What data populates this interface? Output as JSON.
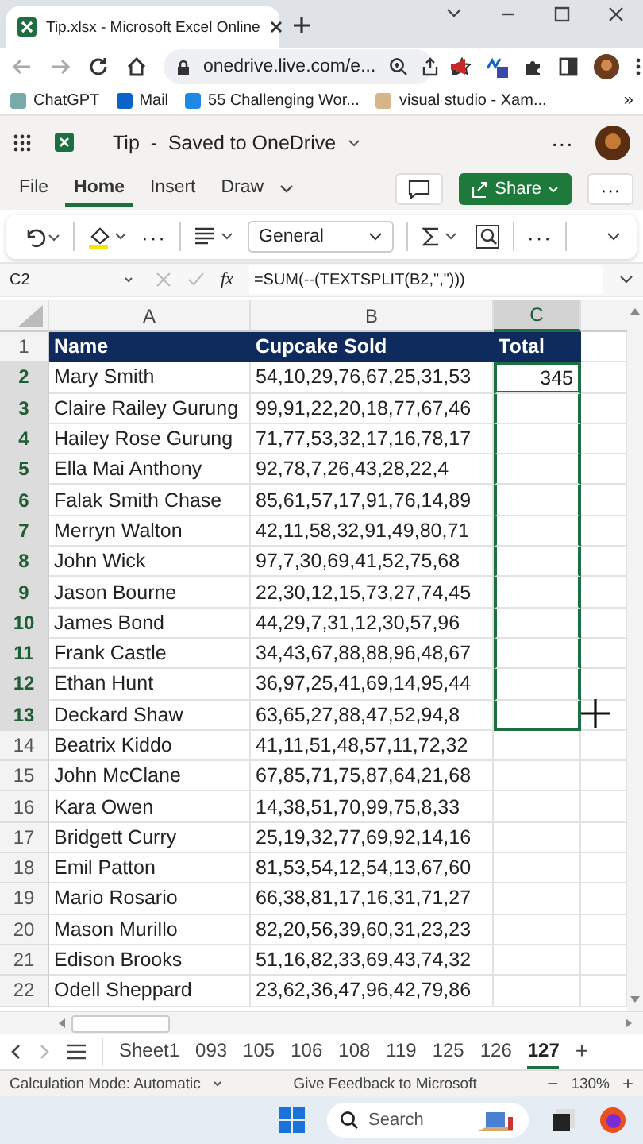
{
  "browser": {
    "tab_title": "Tip.xlsx - Microsoft Excel Online",
    "address": "onedrive.live.com/e...",
    "bookmarks": [
      {
        "label": "ChatGPT"
      },
      {
        "label": "Mail"
      },
      {
        "label": "55 Challenging Wor..."
      },
      {
        "label": "visual studio - Xam..."
      }
    ],
    "more": "»"
  },
  "app": {
    "title": "Tip",
    "separator": "-",
    "status": "Saved to OneDrive",
    "more": "···"
  },
  "ribbon_tabs": [
    {
      "label": "File",
      "selected": false
    },
    {
      "label": "Home",
      "selected": true
    },
    {
      "label": "Insert",
      "selected": false
    },
    {
      "label": "Draw",
      "selected": false
    }
  ],
  "share": "Share",
  "number_format": "General",
  "formula_bar": {
    "name_box": "C2",
    "fx": "fx",
    "formula": "=SUM(--(TEXTSPLIT(B2,\",\")))"
  },
  "columns": [
    {
      "label": "A",
      "selected": false
    },
    {
      "label": "B",
      "selected": false
    },
    {
      "label": "C",
      "selected": true
    }
  ],
  "header": {
    "number": "1",
    "name": "Name",
    "values": "Cupcake Sold",
    "total": "Total"
  },
  "rows": [
    {
      "number": "2",
      "name": "Mary Smith",
      "values": "54,10,29,76,67,25,31,53",
      "total": "345",
      "selected": true
    },
    {
      "number": "3",
      "name": "Claire Railey Gurung",
      "values": "99,91,22,20,18,77,67,46",
      "selected": true
    },
    {
      "number": "4",
      "name": "Hailey Rose Gurung",
      "values": "71,77,53,32,17,16,78,17",
      "selected": true
    },
    {
      "number": "5",
      "name": "Ella Mai Anthony",
      "values": "92,78,7,26,43,28,22,4",
      "selected": true
    },
    {
      "number": "6",
      "name": "Falak Smith Chase",
      "values": "85,61,57,17,91,76,14,89",
      "selected": true
    },
    {
      "number": "7",
      "name": "Merryn Walton",
      "values": "42,11,58,32,91,49,80,71",
      "selected": true
    },
    {
      "number": "8",
      "name": "John Wick",
      "values": "97,7,30,69,41,52,75,68",
      "selected": true
    },
    {
      "number": "9",
      "name": "Jason Bourne",
      "values": "22,30,12,15,73,27,74,45",
      "selected": true
    },
    {
      "number": "10",
      "name": "James Bond",
      "values": "44,29,7,31,12,30,57,96",
      "selected": true
    },
    {
      "number": "11",
      "name": "Frank Castle",
      "values": "34,43,67,88,88,96,48,67",
      "selected": true
    },
    {
      "number": "12",
      "name": "Ethan Hunt",
      "values": "36,97,25,41,69,14,95,44",
      "selected": true
    },
    {
      "number": "13",
      "name": "Deckard Shaw",
      "values": "63,65,27,88,47,52,94,8",
      "selected": true
    },
    {
      "number": "14",
      "name": "Beatrix Kiddo",
      "values": "41,11,51,48,57,11,72,32",
      "selected": false
    },
    {
      "number": "15",
      "name": "John McClane",
      "values": "67,85,71,75,87,64,21,68",
      "selected": false
    },
    {
      "number": "16",
      "name": "Kara Owen",
      "values": "14,38,51,70,99,75,8,33",
      "selected": false
    },
    {
      "number": "17",
      "name": "Bridgett Curry",
      "values": "25,19,32,77,69,92,14,16",
      "selected": false
    },
    {
      "number": "18",
      "name": "Emil Patton",
      "values": "81,53,54,12,54,13,67,60",
      "selected": false
    },
    {
      "number": "19",
      "name": "Mario Rosario",
      "values": "66,38,81,17,16,31,71,27",
      "selected": false
    },
    {
      "number": "20",
      "name": "Mason Murillo",
      "values": "82,20,56,39,60,31,23,23",
      "selected": false
    },
    {
      "number": "21",
      "name": "Edison Brooks",
      "values": "51,16,82,33,69,43,74,32",
      "selected": false
    },
    {
      "number": "22",
      "name": "Odell Sheppard",
      "values": "23,62,36,47,96,42,79,86",
      "selected": false
    }
  ],
  "sheet_tabs": [
    {
      "label": "Sheet1",
      "selected": false
    },
    {
      "label": "093",
      "selected": false
    },
    {
      "label": "105",
      "selected": false
    },
    {
      "label": "106",
      "selected": false
    },
    {
      "label": "108",
      "selected": false
    },
    {
      "label": "119",
      "selected": false
    },
    {
      "label": "125",
      "selected": false
    },
    {
      "label": "126",
      "selected": false
    },
    {
      "label": "127",
      "selected": true
    }
  ],
  "add_sheet": "+",
  "status_bar": {
    "calc_mode": "Calculation Mode: Automatic",
    "feedback": "Give Feedback to Microsoft",
    "zoom_out": "−",
    "zoom": "130%",
    "zoom_in": "+"
  },
  "taskbar": {
    "search_placeholder": "Search"
  }
}
